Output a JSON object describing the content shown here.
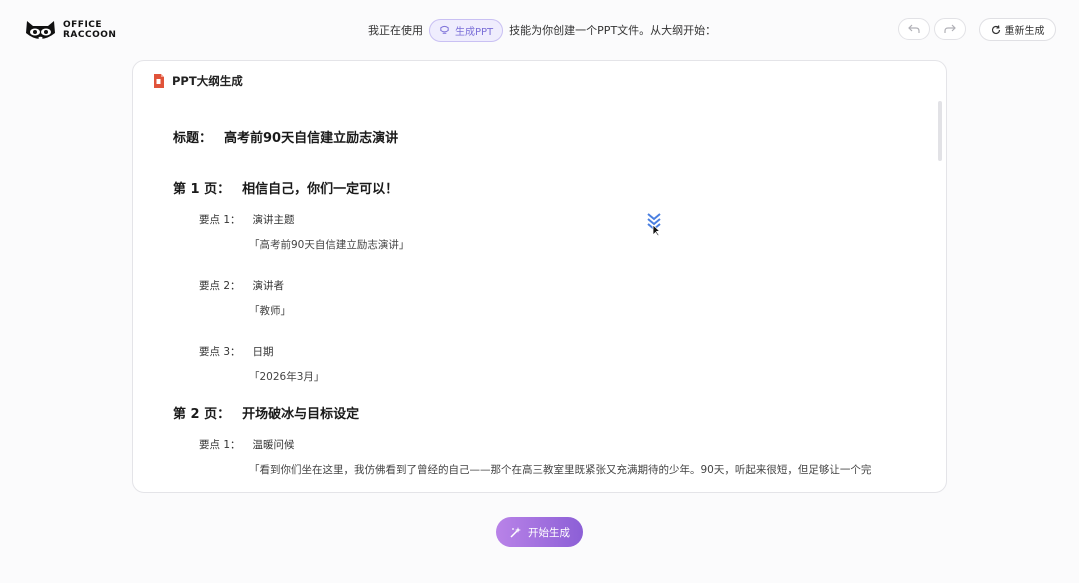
{
  "app": {
    "logo_line1": "OFFICE",
    "logo_line2": "RACCOON"
  },
  "header": {
    "prefix": "我正在使用",
    "skill_label": "生成PPT",
    "suffix": "技能为你创建一个PPT文件。从大纲开始：",
    "undo_icon": "undo-icon",
    "redo_icon": "redo-icon",
    "regenerate_label": "重新生成"
  },
  "card": {
    "heading": "PPT大纲生成",
    "title_label": "标题：",
    "title_value": "高考前90天自信建立励志演讲",
    "pages": [
      {
        "label": "第 1 页：",
        "title": "相信自己，你们一定可以！",
        "points": [
          {
            "label": "要点 1：",
            "name": "演讲主题",
            "detail": "「高考前90天自信建立励志演讲」"
          },
          {
            "label": "要点 2：",
            "name": "演讲者",
            "detail": "「教师」"
          },
          {
            "label": "要点 3：",
            "name": "日期",
            "detail": "「2026年3月」"
          }
        ]
      },
      {
        "label": "第 2 页：",
        "title": "开场破冰与目标设定",
        "points": [
          {
            "label": "要点 1：",
            "name": "温暖问候",
            "detail": "「看到你们坐在这里，我仿佛看到了曾经的自己——那个在高三教室里既紧张又充满期待的少年。90天，听起来很短，但足够让一个完"
          }
        ]
      }
    ]
  },
  "footer": {
    "start_label": "开始生成"
  },
  "colors": {
    "accent": "#8c5fd6",
    "pill_bg": "#efedfd",
    "ppt_icon": "#e0533a"
  }
}
